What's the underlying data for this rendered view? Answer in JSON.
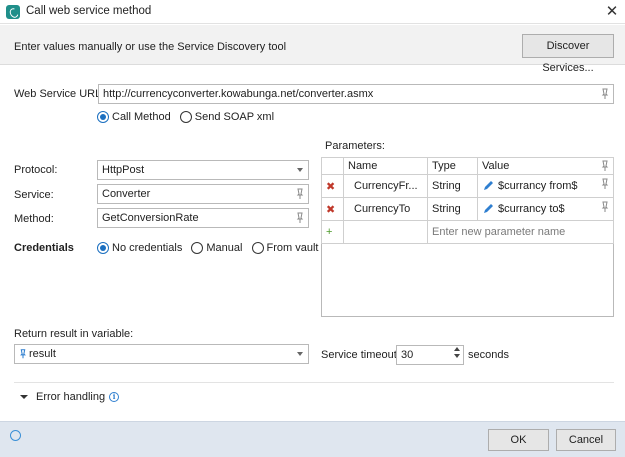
{
  "window": {
    "title": "Call web service method",
    "close_glyph": "✕",
    "icon": "app-logo-icon"
  },
  "info": {
    "text": "Enter values manually or use the Service Discovery tool",
    "discover_label": "Discover Services..."
  },
  "url": {
    "label": "Web Service URL:",
    "value": "http://currencyconverter.kowabunga.net/converter.asmx"
  },
  "mode": {
    "options": [
      "Call Method",
      "Send SOAP xml"
    ],
    "selected": "Call Method"
  },
  "protocol": {
    "label": "Protocol:",
    "value": "HttpPost"
  },
  "service": {
    "label": "Service:",
    "value": "Converter"
  },
  "method": {
    "label": "Method:",
    "value": "GetConversionRate"
  },
  "credentials": {
    "label": "Credentials",
    "options": [
      "No credentials",
      "Manual",
      "From vault"
    ],
    "selected": "No credentials"
  },
  "parameters": {
    "label": "Parameters:",
    "columns": [
      "Name",
      "Type",
      "Value"
    ],
    "rows": [
      {
        "name": "CurrencyFr...",
        "type": "String",
        "value": "$currancy from$"
      },
      {
        "name": "CurrencyTo",
        "type": "String",
        "value": "$currancy to$"
      }
    ],
    "new_placeholder": "Enter new parameter name",
    "delete_glyph": "✖",
    "add_glyph": "+"
  },
  "result": {
    "label": "Return result in variable:",
    "value": "result"
  },
  "timeout": {
    "label": "Service timeout:",
    "value": "30",
    "unit": "seconds"
  },
  "error_handling": {
    "label": "Error handling",
    "info_glyph": "i"
  },
  "buttons": {
    "ok": "OK",
    "cancel": "Cancel"
  },
  "colors": {
    "accent": "#1b6fc0",
    "footer": "#dfe6ef",
    "delete": "#c0392b",
    "add": "#4c9a2a"
  }
}
